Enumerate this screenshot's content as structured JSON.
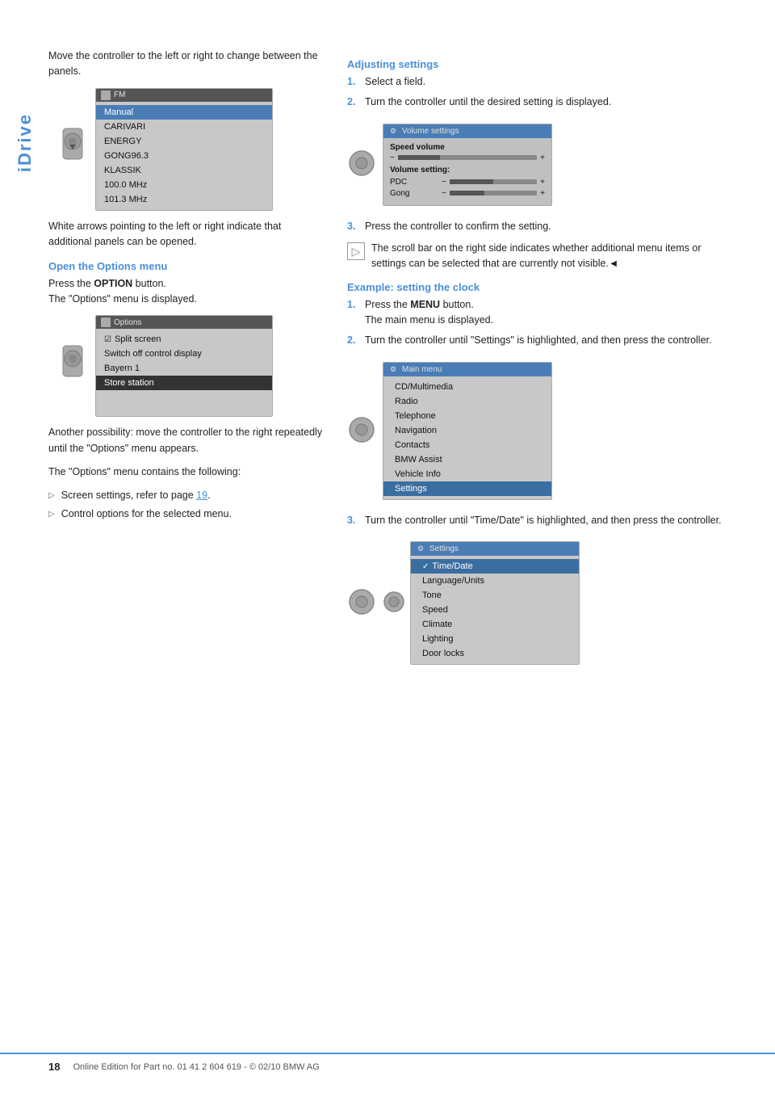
{
  "idrive_label": "iDrive",
  "left_column": {
    "intro_text": "Move the controller to the left or right to change between the panels.",
    "screenshot1": {
      "title_icon": "FM",
      "title_text": "FM",
      "items": [
        {
          "text": "Manual",
          "style": "highlighted"
        },
        {
          "text": "CARIVARI",
          "style": "normal"
        },
        {
          "text": "ENERGY",
          "style": "normal"
        },
        {
          "text": "GONG96.3",
          "style": "normal"
        },
        {
          "text": "KLASSIK",
          "style": "normal"
        },
        {
          "text": "100.0 MHz",
          "style": "normal"
        },
        {
          "text": "101.3 MHz",
          "style": "normal"
        }
      ]
    },
    "white_arrows_text": "White arrows pointing to the left or right indicate that additional panels can be opened.",
    "section_heading": "Open the Options menu",
    "step1_text": "Press the ",
    "step1_bold": "OPTION",
    "step1_suffix": " button.",
    "step1_sub": "The \"Options\" menu is displayed.",
    "screenshot2": {
      "title_text": "Options",
      "items": [
        {
          "text": "Split screen",
          "style": "checkbox",
          "checked": true
        },
        {
          "text": "Switch off control display",
          "style": "normal"
        },
        {
          "text": "Bayern 1",
          "style": "normal"
        },
        {
          "text": "Store station",
          "style": "dark-highlighted"
        }
      ]
    },
    "another_possibility_text": "Another possibility: move the controller to the right repeatedly until the \"Options\" menu appears.",
    "options_contains_text": "The \"Options\" menu contains the following:",
    "bullet1_text": "Screen settings, refer to page ",
    "bullet1_link": "19",
    "bullet1_suffix": ".",
    "bullet2_text": "Control options for the selected menu."
  },
  "right_column": {
    "adjusting_heading": "Adjusting settings",
    "adjust_step1": "Select a field.",
    "adjust_step2": "Turn the controller until the desired setting is displayed.",
    "vol_screenshot": {
      "title": "Volume settings",
      "speed_volume_label": "Speed volume",
      "volume_setting_label": "Volume setting:",
      "pdc_label": "PDC",
      "gong_label": "Gong"
    },
    "adjust_step3": "Press the controller to confirm the setting.",
    "note_text": "The scroll bar on the right side indicates whether additional menu items or settings can be selected that are currently not visible.",
    "back_symbol": "◄",
    "example_heading": "Example: setting the clock",
    "example_step1_text": "Press the ",
    "example_step1_bold": "MENU",
    "example_step1_suffix": " button.",
    "example_step1_sub": "The main menu is displayed.",
    "example_step2": "Turn the controller until \"Settings\" is highlighted, and then press the controller.",
    "main_menu_screenshot": {
      "title": "Main menu",
      "items": [
        {
          "text": "CD/Multimedia",
          "style": "normal"
        },
        {
          "text": "Radio",
          "style": "normal"
        },
        {
          "text": "Telephone",
          "style": "normal"
        },
        {
          "text": "Navigation",
          "style": "normal"
        },
        {
          "text": "Contacts",
          "style": "normal"
        },
        {
          "text": "BMW Assist",
          "style": "normal"
        },
        {
          "text": "Vehicle Info",
          "style": "normal"
        },
        {
          "text": "Settings",
          "style": "highlighted"
        }
      ]
    },
    "example_step3": "Turn the controller until \"Time/Date\" is highlighted, and then press the controller.",
    "settings_screenshot": {
      "title": "Settings",
      "items": [
        {
          "text": "Time/Date",
          "style": "checked-highlighted"
        },
        {
          "text": "Language/Units",
          "style": "normal"
        },
        {
          "text": "Tone",
          "style": "normal"
        },
        {
          "text": "Speed",
          "style": "normal"
        },
        {
          "text": "Climate",
          "style": "normal"
        },
        {
          "text": "Lighting",
          "style": "normal"
        },
        {
          "text": "Door locks",
          "style": "normal"
        }
      ]
    }
  },
  "footer": {
    "page_number": "18",
    "footer_text": "Online Edition for Part no. 01 41 2 604 619 - © 02/10 BMW AG"
  }
}
